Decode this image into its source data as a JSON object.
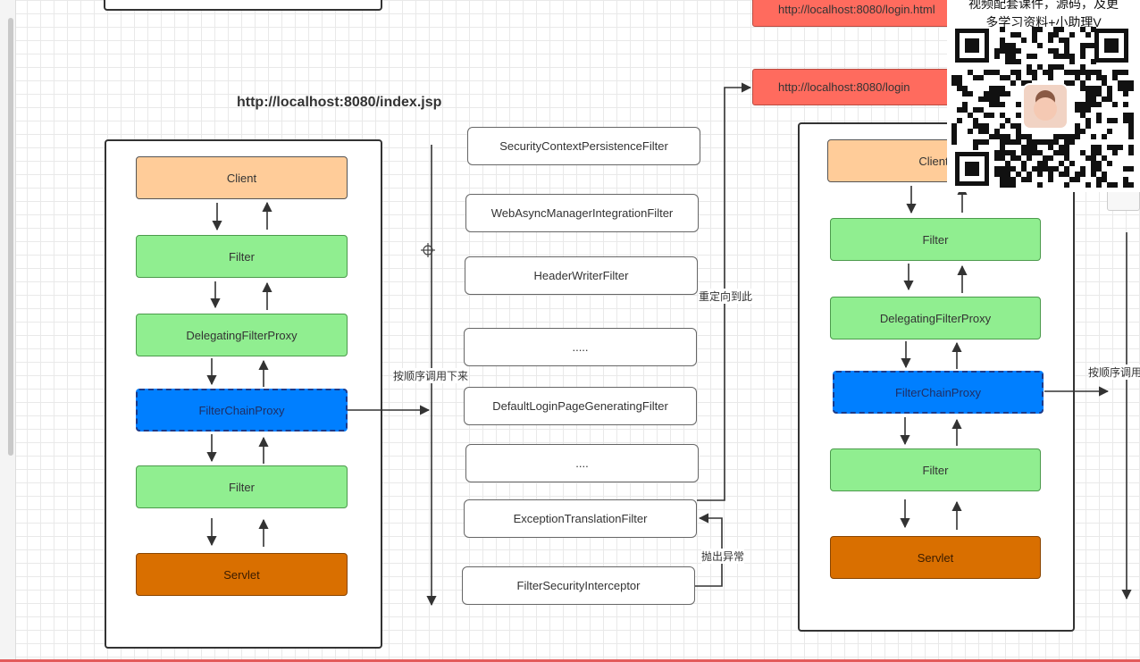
{
  "left_diagram": {
    "title": "http://localhost:8080/index.jsp",
    "nodes": [
      "Client",
      "Filter",
      "DelegatingFilterProxy",
      "FilterChainProxy",
      "Filter",
      "Servlet"
    ]
  },
  "filter_chain": {
    "axis_label": "按顺序调用下来",
    "filters": [
      "SecurityContextPersistenceFilter",
      "WebAsyncManagerIntegrationFilter",
      "HeaderWriterFilter",
      ".....",
      "DefaultLoginPageGeneratingFilter",
      "....",
      "ExceptionTranslationFilter",
      "FilterSecurityInterceptor"
    ],
    "redirect_label": "重定向到此",
    "throw_label": "抛出异常"
  },
  "urls": {
    "top": "http://localhost:8080/login.html",
    "login": "http://localhost:8080/login"
  },
  "right_diagram": {
    "nodes": [
      "Client",
      "Filter",
      "DelegatingFilterProxy",
      "FilterChainProxy",
      "Filter",
      "Servlet"
    ],
    "axis_label": "按顺序调用"
  },
  "watermark": {
    "line1": "视频配套课件，源码，及更",
    "line2": "多学习资料+小助理V"
  },
  "colors": {
    "client": "#ffcc99",
    "filter": "#90ee90",
    "filter_chain_proxy": "#007fff",
    "servlet": "#d96f00",
    "url_box": "#ff6b5e"
  }
}
